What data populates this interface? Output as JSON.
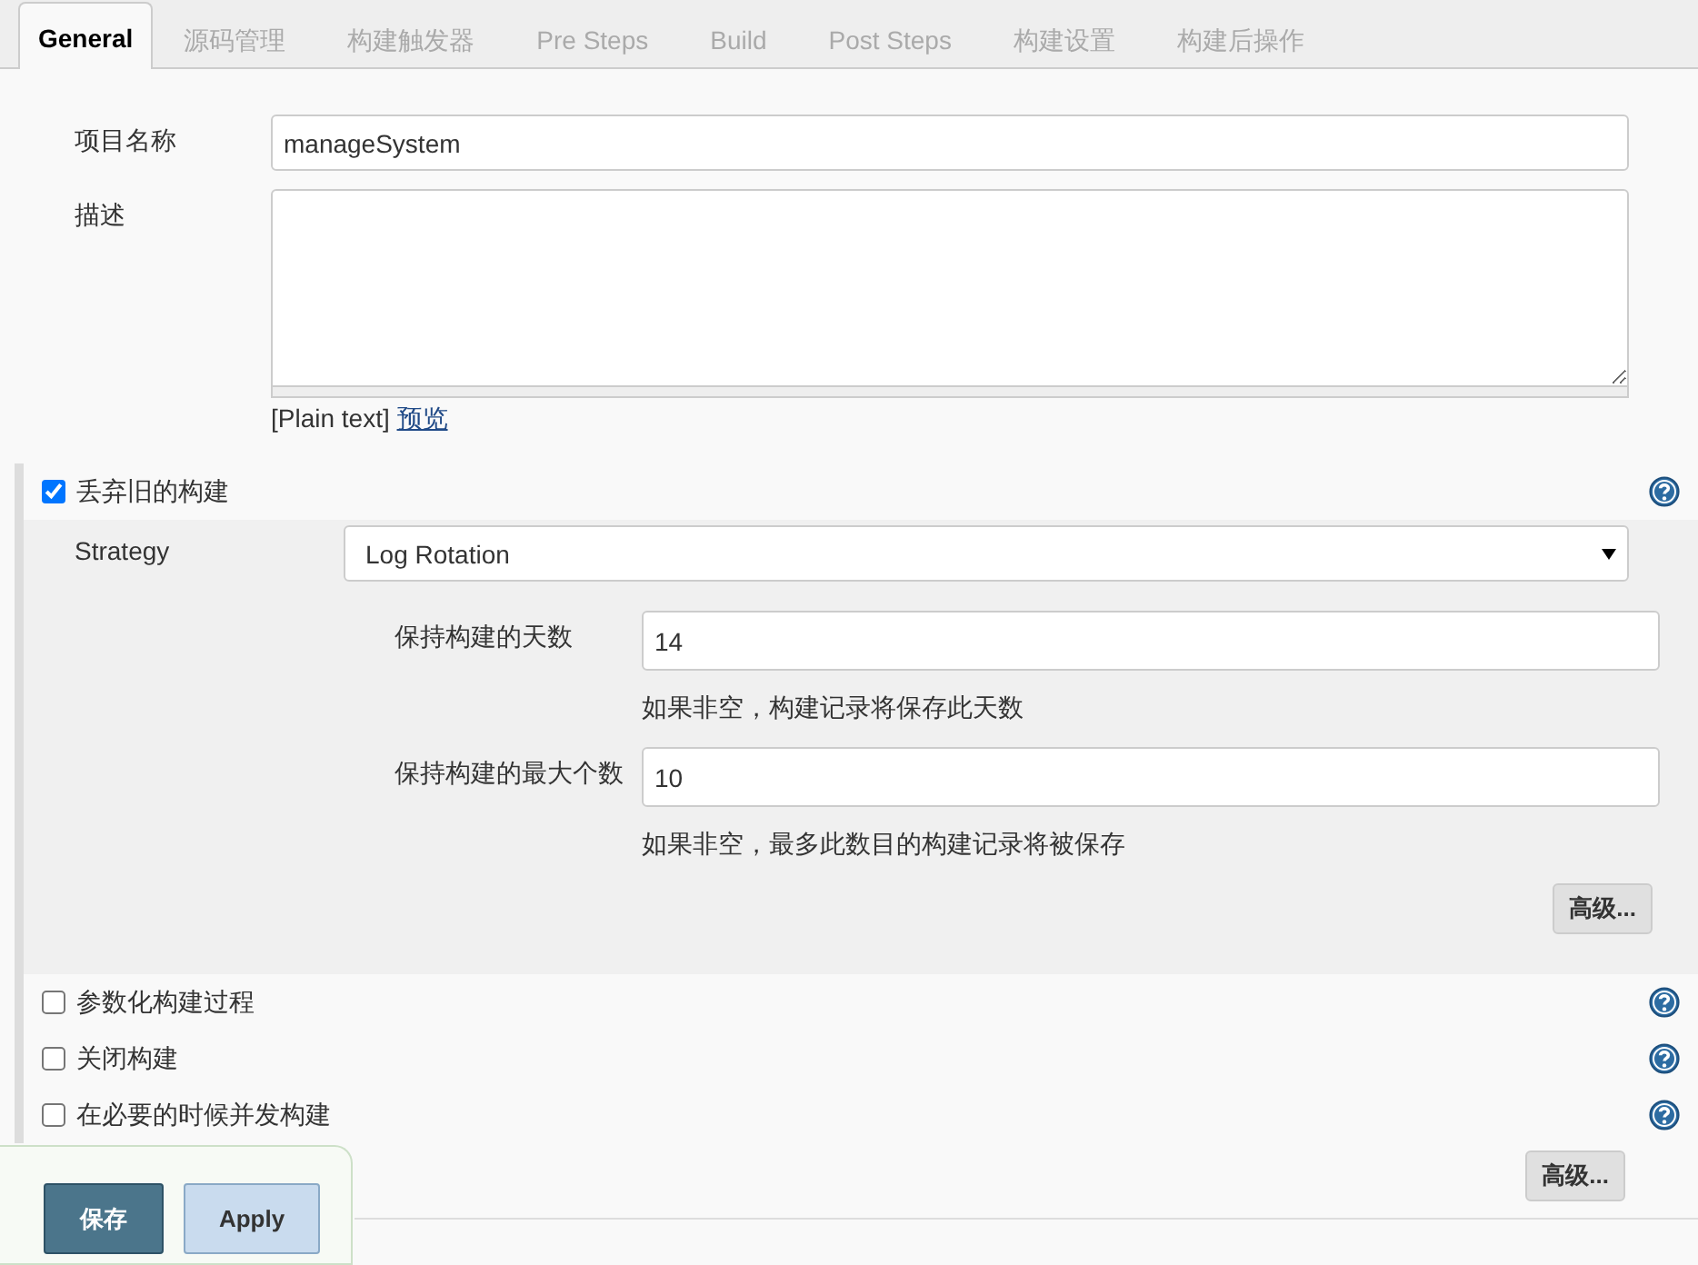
{
  "tabs": [
    {
      "label": "General",
      "selected": true
    },
    {
      "label": "源码管理",
      "selected": false
    },
    {
      "label": "构建触发器",
      "selected": false
    },
    {
      "label": "Pre Steps",
      "selected": false
    },
    {
      "label": "Build",
      "selected": false
    },
    {
      "label": "Post Steps",
      "selected": false
    },
    {
      "label": "构建设置",
      "selected": false
    },
    {
      "label": "构建后操作",
      "selected": false
    }
  ],
  "project_name": {
    "label": "项目名称",
    "value": "manageSystem"
  },
  "description": {
    "label": "描述",
    "format_note": "[Plain text]",
    "preview_link": "预览"
  },
  "discard_old_builds": {
    "label": "丢弃旧的构建",
    "checked": true,
    "strategy": {
      "label": "Strategy",
      "value": "Log Rotation"
    },
    "settings": [
      {
        "label": "保持构建的天数",
        "value": "14",
        "hint": "如果非空，构建记录将保存此天数"
      },
      {
        "label": "保持构建的最大个数",
        "value": "10",
        "hint": "如果非空，最多此数目的构建记录将被保存"
      }
    ],
    "advanced_button": "高级..."
  },
  "options": [
    {
      "label": "参数化构建过程",
      "checked": false
    },
    {
      "label": "关闭构建",
      "checked": false
    },
    {
      "label": "在必要的时候并发构建",
      "checked": false
    }
  ],
  "advanced_button": "高级...",
  "buttons": [
    {
      "label": "保存",
      "kind": "primary"
    },
    {
      "label": "Apply",
      "kind": "secondary"
    }
  ]
}
